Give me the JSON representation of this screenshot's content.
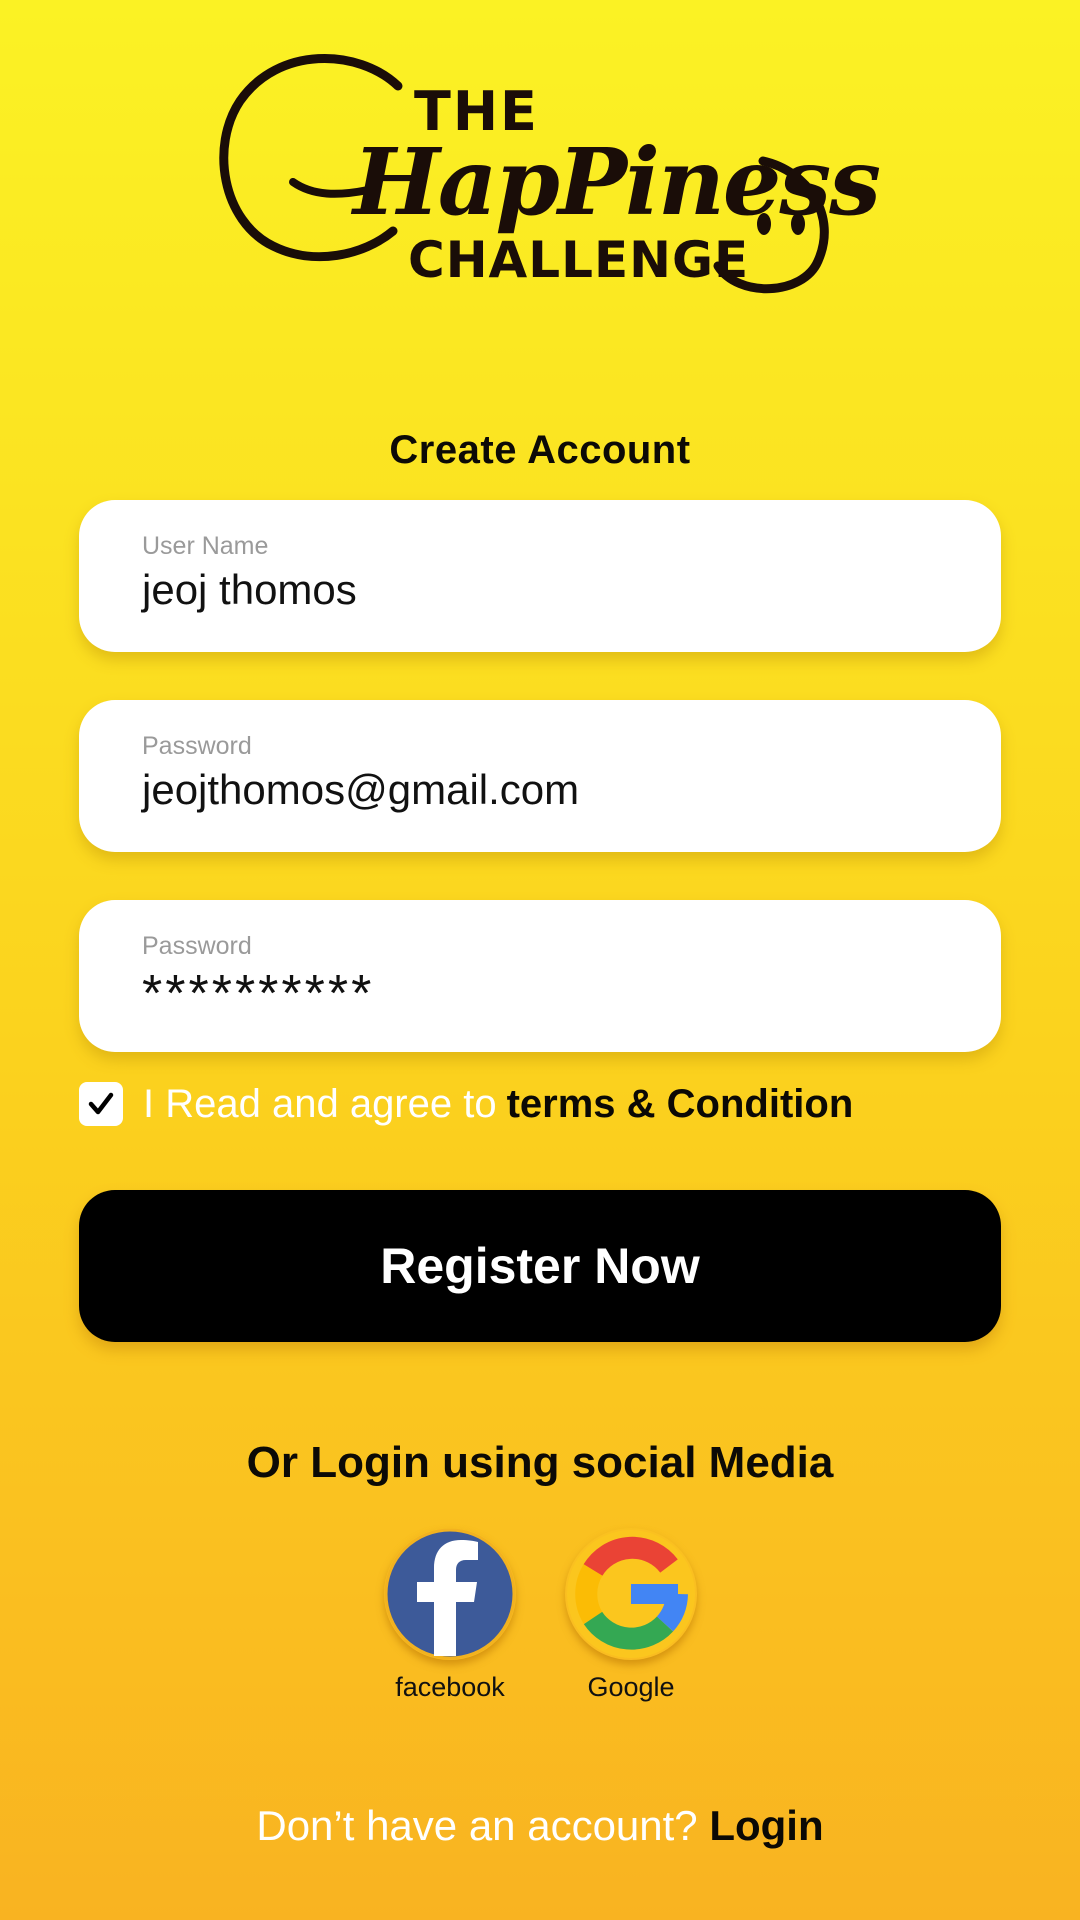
{
  "logo": {
    "line1": "THE",
    "line2": "HapPiness",
    "line3": "CHALLENGE"
  },
  "title": "Create Account",
  "fields": [
    {
      "label": "User Name",
      "value": "jeoj thomos"
    },
    {
      "label": "Password",
      "value": "jeojthomos@gmail.com"
    },
    {
      "label": "Password",
      "value": "**********"
    }
  ],
  "agreement": {
    "checked": true,
    "text": "I Read and agree to",
    "link": "terms & Condition"
  },
  "register_button": "Register Now",
  "social_heading": "Or Login using social Media",
  "social": [
    {
      "label": "facebook",
      "icon": "facebook-icon",
      "color": "#3d5a99"
    },
    {
      "label": "Google",
      "icon": "google-icon"
    }
  ],
  "footer": {
    "text": "Don’t have an account?",
    "link": "Login"
  },
  "colors": {
    "background_top": "#fbf224",
    "background_bottom": "#f9b321",
    "button": "#000000",
    "logo": "#1a0d08"
  }
}
